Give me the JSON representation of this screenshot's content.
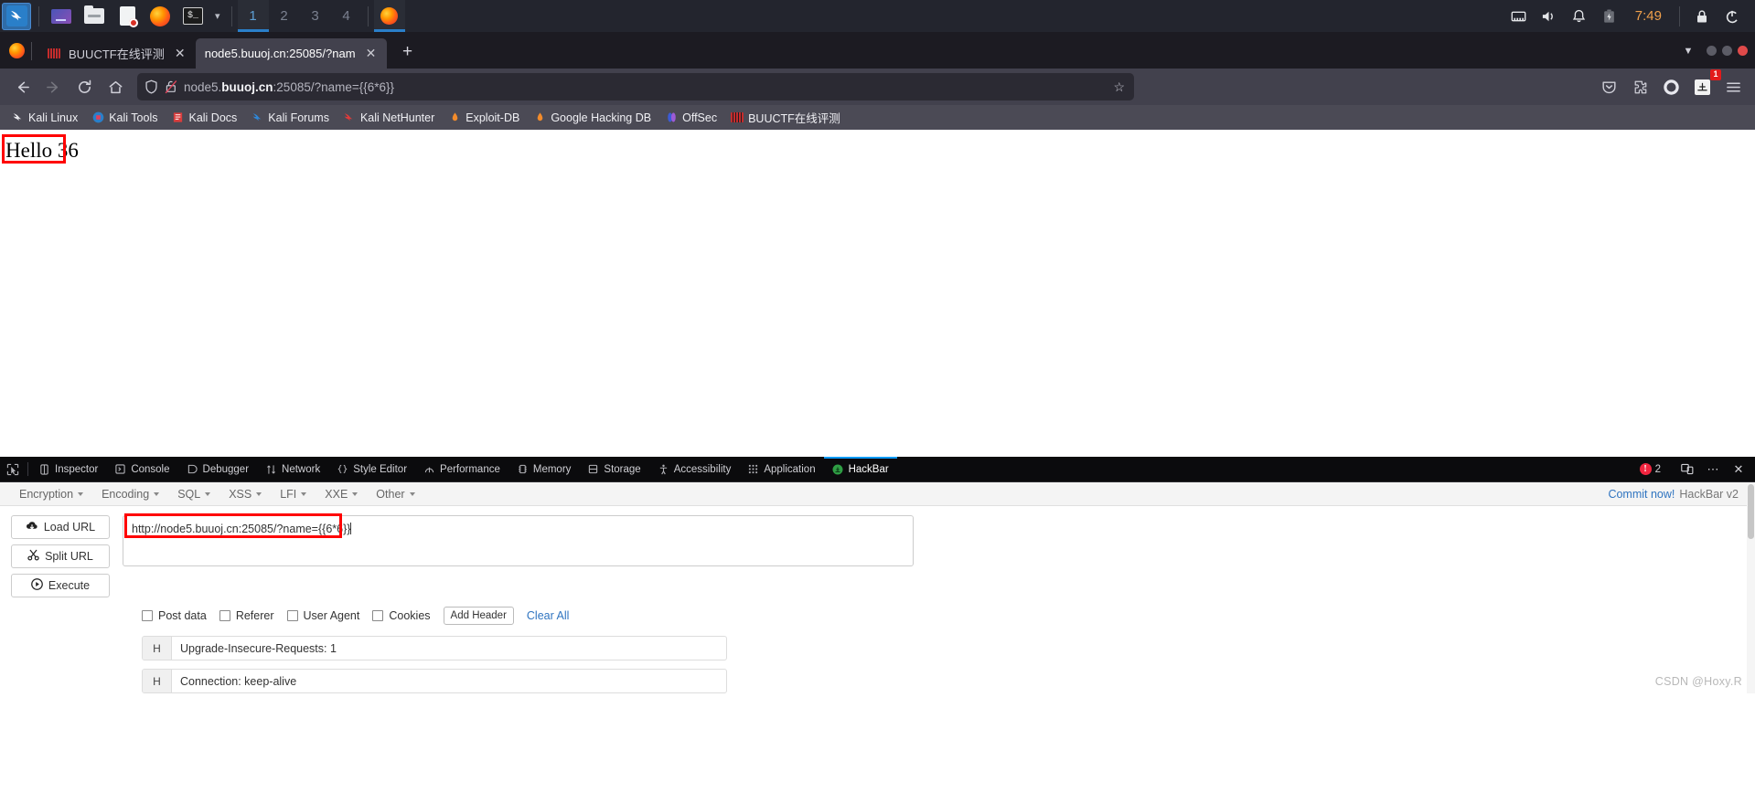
{
  "desktop_panel": {
    "launchers": [
      {
        "name": "kali-menu",
        "icon": "kali-dragon-icon",
        "active": true
      },
      {
        "name": "file-manager",
        "icon": "file-manager-icon"
      },
      {
        "name": "folder",
        "icon": "folder-icon"
      },
      {
        "name": "text-editor",
        "icon": "document-icon"
      },
      {
        "name": "firefox",
        "icon": "firefox-icon"
      },
      {
        "name": "terminal",
        "icon": "terminal-icon"
      }
    ],
    "workspaces": [
      "1",
      "2",
      "3",
      "4"
    ],
    "active_workspace": "1",
    "window_buttons": [
      {
        "label": "",
        "icon": "firefox-icon"
      }
    ],
    "tray": [
      "network-icon",
      "volume-icon",
      "notification-bell-icon",
      "battery-icon"
    ],
    "clock": "7:49",
    "session": [
      "lock-icon",
      "logout-icon"
    ]
  },
  "browser": {
    "tabs": [
      {
        "title": "BUUCTF在线评测",
        "favicon": "buuctf-favicon",
        "active": false,
        "close": "✕"
      },
      {
        "title": "node5.buuoj.cn:25085/?nam",
        "favicon": "none",
        "active": true,
        "close": "✕"
      }
    ],
    "new_tab_label": "+",
    "list_all_tabs": "⌄",
    "window_controls": [
      "minimize",
      "maximize",
      "close"
    ],
    "nav": {
      "back": "←",
      "forward": "→",
      "reload": "↻",
      "home": "⌂"
    },
    "urlbar": {
      "shield_icon": "tracking-protection-shield-icon",
      "lock_icon": "insecure-connection-icon",
      "url_host": "node5.buuoj.cn",
      "url_prefix": "node5.",
      "url_rest": ":25085/?name={{6*6}}",
      "url_full": "node5.buuoj.cn:25085/?name={{6*6}}",
      "bookmark_star": "☆"
    },
    "toolbar_right": [
      {
        "name": "save-to-pocket-icon"
      },
      {
        "name": "extensions-puzzle-icon"
      },
      {
        "name": "account-circle-icon"
      },
      {
        "name": "hackbar-extension-icon",
        "badge": "1"
      },
      {
        "name": "app-menu-icon"
      }
    ],
    "bookmarks": [
      {
        "label": "Kali Linux",
        "icon": "kali-dragon-icon"
      },
      {
        "label": "Kali Tools",
        "icon": "kali-tools-icon"
      },
      {
        "label": "Kali Docs",
        "icon": "kali-docs-icon"
      },
      {
        "label": "Kali Forums",
        "icon": "kali-forums-icon"
      },
      {
        "label": "Kali NetHunter",
        "icon": "kali-nethunter-icon"
      },
      {
        "label": "Exploit-DB",
        "icon": "exploit-db-icon"
      },
      {
        "label": "Google Hacking DB",
        "icon": "google-hacking-db-icon"
      },
      {
        "label": "OffSec",
        "icon": "offsec-icon"
      },
      {
        "label": "BUUCTF在线评测",
        "icon": "buuctf-favicon"
      }
    ]
  },
  "page": {
    "body_text": "Hello 36",
    "annotation_color": "#ff0000"
  },
  "devtools": {
    "picker_icon": "element-picker-icon",
    "tabs": [
      {
        "label": "Inspector",
        "icon": "inspector-icon",
        "active": false
      },
      {
        "label": "Console",
        "icon": "console-icon",
        "active": false
      },
      {
        "label": "Debugger",
        "icon": "debugger-icon",
        "active": false
      },
      {
        "label": "Network",
        "icon": "network-icon",
        "active": false
      },
      {
        "label": "Style Editor",
        "icon": "style-editor-icon",
        "active": false
      },
      {
        "label": "Performance",
        "icon": "performance-icon",
        "active": false
      },
      {
        "label": "Memory",
        "icon": "memory-icon",
        "active": false
      },
      {
        "label": "Storage",
        "icon": "storage-icon",
        "active": false
      },
      {
        "label": "Accessibility",
        "icon": "accessibility-icon",
        "active": false
      },
      {
        "label": "Application",
        "icon": "application-icon",
        "active": false
      },
      {
        "label": "HackBar",
        "icon": "hackbar-icon",
        "active": true
      }
    ],
    "error_count": "2",
    "buttons": [
      {
        "name": "responsive-design-mode-icon"
      },
      {
        "name": "devtools-meatball-menu-icon"
      },
      {
        "name": "devtools-close-icon"
      }
    ]
  },
  "hackbar": {
    "menus": [
      "Encryption",
      "Encoding",
      "SQL",
      "XSS",
      "LFI",
      "XXE",
      "Other"
    ],
    "commit_link": "Commit now!",
    "version_label": "HackBar v2",
    "actions": [
      {
        "label": "Load URL",
        "icon": "cloud-download-icon"
      },
      {
        "label": "Split URL",
        "icon": "scissors-icon"
      },
      {
        "label": "Execute",
        "icon": "play-icon"
      }
    ],
    "url_value": "http://node5.buuoj.cn:25085/?name={{6*6}}",
    "url_placeholder": "",
    "checkboxes": [
      {
        "label": "Post data",
        "checked": false
      },
      {
        "label": "Referer",
        "checked": false
      },
      {
        "label": "User Agent",
        "checked": false
      },
      {
        "label": "Cookies",
        "checked": false
      }
    ],
    "add_header_label": "Add Header",
    "clear_all_label": "Clear All",
    "headers": [
      {
        "prefix": "H",
        "value": "Upgrade-Insecure-Requests: 1"
      },
      {
        "prefix": "H",
        "value": "Connection: keep-alive"
      }
    ]
  },
  "watermark": "CSDN @Hoxy.R"
}
